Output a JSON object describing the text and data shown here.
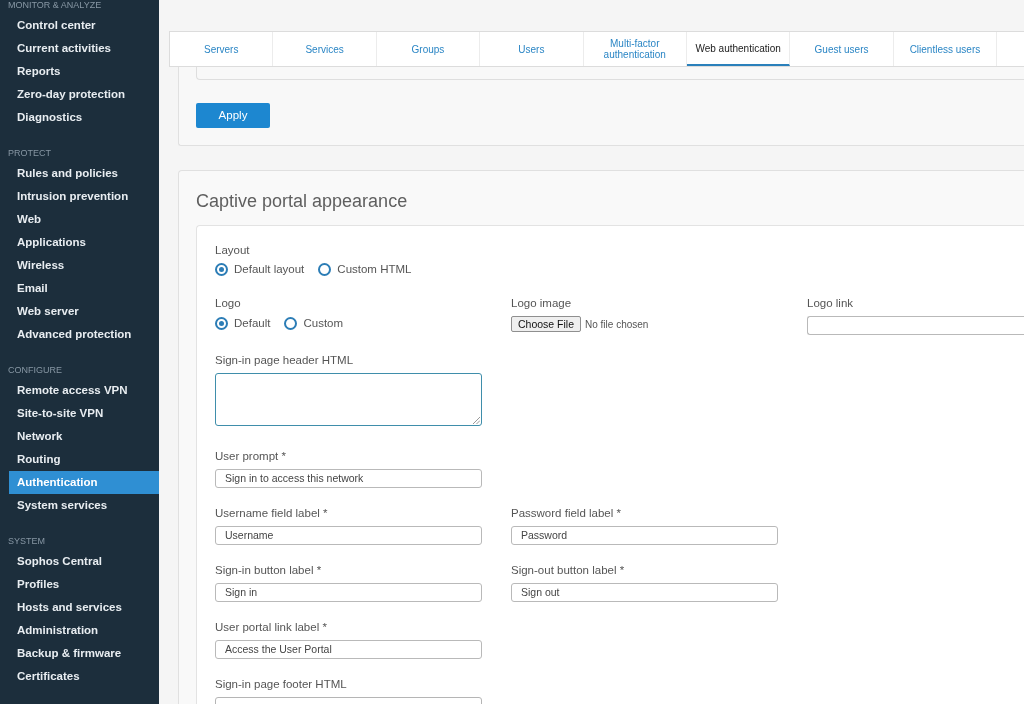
{
  "sidebar": {
    "sections": [
      {
        "heading": "MONITOR & ANALYZE",
        "items": [
          {
            "label": "Control center",
            "selected": false
          },
          {
            "label": "Current activities",
            "selected": false
          },
          {
            "label": "Reports",
            "selected": false
          },
          {
            "label": "Zero-day protection",
            "selected": false
          },
          {
            "label": "Diagnostics",
            "selected": false
          }
        ]
      },
      {
        "heading": "PROTECT",
        "items": [
          {
            "label": "Rules and policies",
            "selected": false
          },
          {
            "label": "Intrusion prevention",
            "selected": false
          },
          {
            "label": "Web",
            "selected": false
          },
          {
            "label": "Applications",
            "selected": false
          },
          {
            "label": "Wireless",
            "selected": false
          },
          {
            "label": "Email",
            "selected": false
          },
          {
            "label": "Web server",
            "selected": false
          },
          {
            "label": "Advanced protection",
            "selected": false
          }
        ]
      },
      {
        "heading": "CONFIGURE",
        "items": [
          {
            "label": "Remote access VPN",
            "selected": false
          },
          {
            "label": "Site-to-site VPN",
            "selected": false
          },
          {
            "label": "Network",
            "selected": false
          },
          {
            "label": "Routing",
            "selected": false
          },
          {
            "label": "Authentication",
            "selected": true
          },
          {
            "label": "System services",
            "selected": false
          }
        ]
      },
      {
        "heading": "SYSTEM",
        "items": [
          {
            "label": "Sophos Central",
            "selected": false
          },
          {
            "label": "Profiles",
            "selected": false
          },
          {
            "label": "Hosts and services",
            "selected": false
          },
          {
            "label": "Administration",
            "selected": false
          },
          {
            "label": "Backup & firmware",
            "selected": false
          },
          {
            "label": "Certificates",
            "selected": false
          }
        ]
      }
    ]
  },
  "tabs": [
    {
      "label": "Servers",
      "selected": false
    },
    {
      "label": "Services",
      "selected": false
    },
    {
      "label": "Groups",
      "selected": false
    },
    {
      "label": "Users",
      "selected": false
    },
    {
      "label": "Multi-factor authentication",
      "selected": false
    },
    {
      "label": "Web authentication",
      "selected": true
    },
    {
      "label": "Guest users",
      "selected": false
    },
    {
      "label": "Clientless users",
      "selected": false
    }
  ],
  "apply_button": {
    "label": "Apply"
  },
  "captive_portal": {
    "title": "Captive portal appearance",
    "layout": {
      "label": "Layout",
      "options": [
        {
          "label": "Default layout",
          "selected": true
        },
        {
          "label": "Custom HTML",
          "selected": false
        }
      ]
    },
    "logo": {
      "label": "Logo",
      "options": [
        {
          "label": "Default",
          "selected": true
        },
        {
          "label": "Custom",
          "selected": false
        }
      ]
    },
    "logo_image": {
      "label": "Logo image",
      "button": "Choose File",
      "status": "No file chosen"
    },
    "logo_link": {
      "label": "Logo link"
    },
    "rows": [
      {
        "fields": [
          {
            "kind": "textarea",
            "label": "Sign-in page header HTML",
            "focused": true
          }
        ]
      },
      {
        "fields": [
          {
            "kind": "text",
            "label": "User prompt *",
            "value": "Sign in to access this network"
          }
        ]
      },
      {
        "fields": [
          {
            "kind": "text",
            "label": "Username field label *",
            "value": "Username"
          },
          {
            "kind": "text",
            "label": "Password field label *",
            "value": "Password"
          }
        ]
      },
      {
        "fields": [
          {
            "kind": "text",
            "label": "Sign-in button label *",
            "value": "Sign in"
          },
          {
            "kind": "text",
            "label": "Sign-out button label *",
            "value": "Sign out"
          }
        ]
      },
      {
        "fields": [
          {
            "kind": "text",
            "label": "User portal link label *",
            "value": "Access the User Portal"
          }
        ]
      },
      {
        "fields": [
          {
            "kind": "textarea",
            "label": "Sign-in page footer HTML",
            "focused": false
          }
        ]
      }
    ]
  }
}
